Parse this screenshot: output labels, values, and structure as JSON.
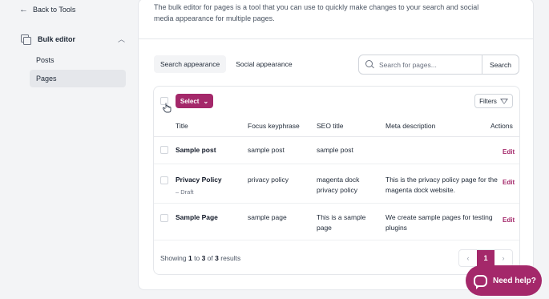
{
  "sidebar": {
    "back_label": "Back to Tools",
    "group_label": "Bulk editor",
    "items": [
      {
        "label": "Posts"
      },
      {
        "label": "Pages"
      }
    ]
  },
  "header": {
    "description": "The bulk editor for pages is a tool that you can use to quickly make changes to your search and social media appearance for multiple pages."
  },
  "tabs": [
    {
      "label": "Search appearance",
      "active": true
    },
    {
      "label": "Social appearance",
      "active": false
    }
  ],
  "search": {
    "placeholder": "Search for pages...",
    "value": "",
    "button_label": "Search"
  },
  "toolbar": {
    "select_label": "Select",
    "filters_label": "Filters"
  },
  "table": {
    "columns": [
      "Title",
      "Focus keyphrase",
      "SEO title",
      "Meta description",
      "Actions"
    ],
    "rows": [
      {
        "title": "Sample post",
        "status": "",
        "keyphrase": "sample post",
        "seo_title": "sample post",
        "meta": "",
        "action": "Edit"
      },
      {
        "title": "Privacy Policy",
        "status": "– Draft",
        "keyphrase": "privacy policy",
        "seo_title": "magenta dock privacy policy",
        "meta": "This is the privacy policy page for the magenta dock website.",
        "action": "Edit"
      },
      {
        "title": "Sample Page",
        "status": "",
        "keyphrase": "sample page",
        "seo_title": "This is a sample page",
        "meta": "We create sample pages for testing plugins",
        "action": "Edit"
      }
    ]
  },
  "footer": {
    "showing_prefix": "Showing",
    "range_start": "1",
    "to_word": "to",
    "range_end": "3",
    "of_word": "of",
    "total": "3",
    "results_word": "results",
    "prev_icon": "‹",
    "current_page": "1",
    "next_icon": "›"
  },
  "help": {
    "label": "Need help?"
  },
  "colors": {
    "accent": "#a4286a"
  },
  "icons": {
    "back": "arrow-left-icon",
    "group": "copy-icon",
    "collapse": "chevron-up-icon",
    "search": "search-icon",
    "filters": "funnel-icon",
    "help": "chat-bubble-icon"
  }
}
